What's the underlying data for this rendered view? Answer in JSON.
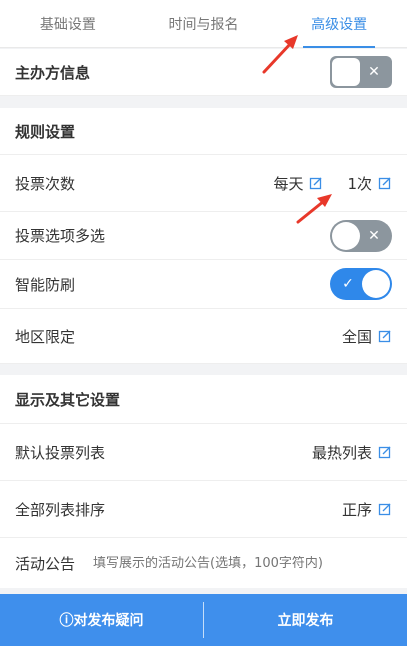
{
  "tabs": [
    {
      "label": "基础设置"
    },
    {
      "label": "时间与报名"
    },
    {
      "label": "高级设置"
    }
  ],
  "organizer": {
    "label": "主办方信息",
    "enabled": false
  },
  "rules": {
    "section_title": "规则设置",
    "vote_count": {
      "label": "投票次数",
      "period": "每天",
      "count": "1次"
    },
    "multi_select": {
      "label": "投票选项多选",
      "enabled": false
    },
    "anti_fraud": {
      "label": "智能防刷",
      "enabled": true
    },
    "region": {
      "label": "地区限定",
      "value": "全国"
    }
  },
  "display": {
    "section_title": "显示及其它设置",
    "default_list": {
      "label": "默认投票列表",
      "value": "最热列表"
    },
    "list_order": {
      "label": "全部列表排序",
      "value": "正序"
    },
    "notice": {
      "label": "活动公告",
      "placeholder": "填写展示的活动公告(选填，100字符内)"
    }
  },
  "bottom": {
    "question_button": "ⓘ对发布疑问",
    "publish_button": "立即发布"
  },
  "icons": {
    "edit": "edit-icon",
    "close": "close-icon",
    "check": "check-icon"
  },
  "colors": {
    "accent": "#3a8ee6",
    "bottom_bar": "#3f8fec",
    "toggle_off": "#8c969e",
    "toggle_on": "#2f88ea",
    "annotation_arrow": "#e8382a"
  }
}
